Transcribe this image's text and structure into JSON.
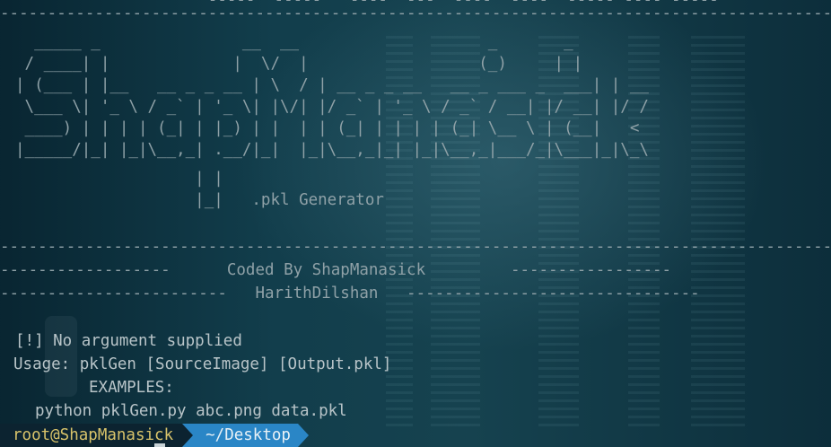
{
  "colors": {
    "background": "#0f3340",
    "text": "#b8c4c8",
    "prompt_user": "#d8c36a",
    "prompt_dir_bg": "#2a86c6"
  },
  "banner": {
    "top_partial": "                      -----  -----   ----  ---  ----  ----  ----- ---- -----",
    "rule_top": "------------------------------------------------------------------------------------------",
    "ascii": [
      "  _____ _               __  __                    _       _    ",
      " / ____| |             |  \\/  |                  (_)     | |   ",
      "| (___ | |__   __ _ _ __ | \\  / | __ _ _ __   __ _ ___ _  ___| | __",
      " \\___ \\| '_ \\ / _` | '_ \\| |\\/| |/ _` | '_ \\ / _` / __| |/ __| |/ /",
      " ____) | | | | (_| | |_) | |  | | (_| | | | | (_| \\__ \\ | (__|   < ",
      "|_____/|_| |_|\\__,_| .__/|_|  |_|\\__,_|_| |_|\\__,_|___/_|\\___|_|\\_\\",
      "                   | |",
      "                   |_|   .pkl Generator"
    ],
    "rule_mid": "------------------------------------------------------------------------------------------",
    "coded_by_line": "------------------      Coded By ShapManasick         -----------------",
    "author_line": "------------------------   HarithDilshan   -------------------------------"
  },
  "output": {
    "error": "[!] No argument supplied",
    "usage": "Usage: pklGen [SourceImage] [Output.pkl]",
    "examples_label": "EXAMPLES:",
    "example_cmd": "python pklGen.py abc.png data.pkl"
  },
  "prompt": {
    "user_host": "root@ShapManasick",
    "directory": "~/Desktop"
  }
}
